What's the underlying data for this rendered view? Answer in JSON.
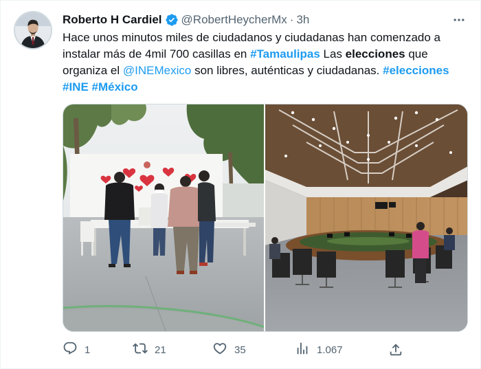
{
  "tweet": {
    "author_name": "Roberto H Cardiel",
    "handle": "@RobertHeycherMx",
    "separator": "·",
    "time": "3h",
    "text_lines": [
      [
        {
          "t": "Hace unos minutos miles de ciudadanos y ciudadanas han comenzado a",
          "k": "plain"
        }
      ],
      [
        {
          "t": "instalar más de 4mil 700 casillas en ",
          "k": "plain"
        },
        {
          "t": "#Tamaulipas",
          "k": "hashtag"
        },
        {
          "t": " Las ",
          "k": "plain"
        },
        {
          "t": "elecciones",
          "k": "bold"
        },
        {
          "t": " que",
          "k": "plain"
        }
      ],
      [
        {
          "t": "organiza el ",
          "k": "plain"
        },
        {
          "t": "@INEMexico",
          "k": "mention"
        },
        {
          "t": " son libres, auténticas y ciudadanas. ",
          "k": "plain"
        },
        {
          "t": "#elecciones",
          "k": "hashtag"
        }
      ],
      [
        {
          "t": "#INE",
          "k": "hashtag"
        },
        {
          "t": " ",
          "k": "plain"
        },
        {
          "t": "#México",
          "k": "hashtag"
        }
      ]
    ]
  },
  "actions": {
    "replies": "1",
    "reposts": "21",
    "likes": "35",
    "views": "1.067"
  },
  "icons": {
    "verified": "verified-badge-icon",
    "more": "more-dots-icon",
    "reply": "reply-icon",
    "repost": "repost-icon",
    "like": "heart-icon",
    "views": "views-chart-icon",
    "share": "share-icon"
  },
  "colors": {
    "link": "#1d9bf0",
    "muted": "#536471",
    "text": "#0f1419"
  }
}
